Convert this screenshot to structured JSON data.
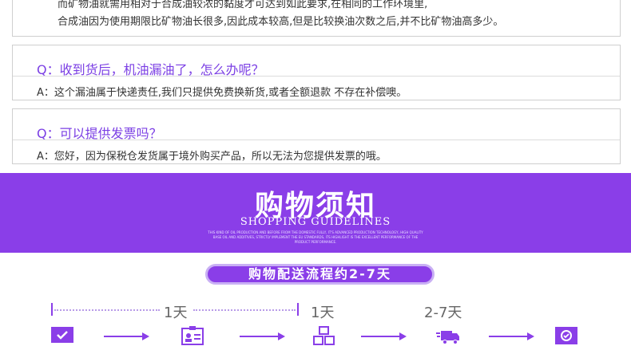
{
  "faq_top": {
    "line1": "而矿物油就需用相对于合成油较浓的黏度才可达到如此要求,在相同的工作环境里,",
    "line2": "合成油因为使用期限比矿物油长很多,因此成本较高,但是比较换油次数之后,并不比矿物油高多少。"
  },
  "faq": [
    {
      "question": "Q：收到货后，机油漏油了，怎么办呢？",
      "answer": "A：这个漏油属于快递责任,我们只提供免费换新货,或者全额退款 不存在补偿噢。"
    },
    {
      "question": "Q：可以提供发票吗？",
      "answer": "A：您好，因为保税仓发货属于境外购买产品，所以无法为您提供发票的哦。"
    }
  ],
  "banner": {
    "title": "购物须知",
    "subtitle": "SHOPPING GUIDELINES",
    "fine_print": "THIS KIND OF OIL PRODUCTION AND BEFORE FROM THE DOMESTIC FULLY, IT'S ADVANCED PRODUCTION TECHNOLOGY, HIGH QUALITY BASE OIL AND ADDITIVES, STRICTLY IMPLEMENT THE EU STANDARDS, ITS HIGHLIGHT IS THE EXCELLENT PERFORMANCE OF THE PRODUCT PERFORMANCE."
  },
  "process": {
    "label": "购物配送流程约2-7天",
    "durations": [
      "1天",
      "1天",
      "2-7天"
    ],
    "accent_color": "#8a3ee8",
    "icons": [
      "order-check-icon",
      "id-card-icon",
      "warehouse-boxes-icon",
      "delivery-truck-icon",
      "received-package-icon"
    ]
  }
}
